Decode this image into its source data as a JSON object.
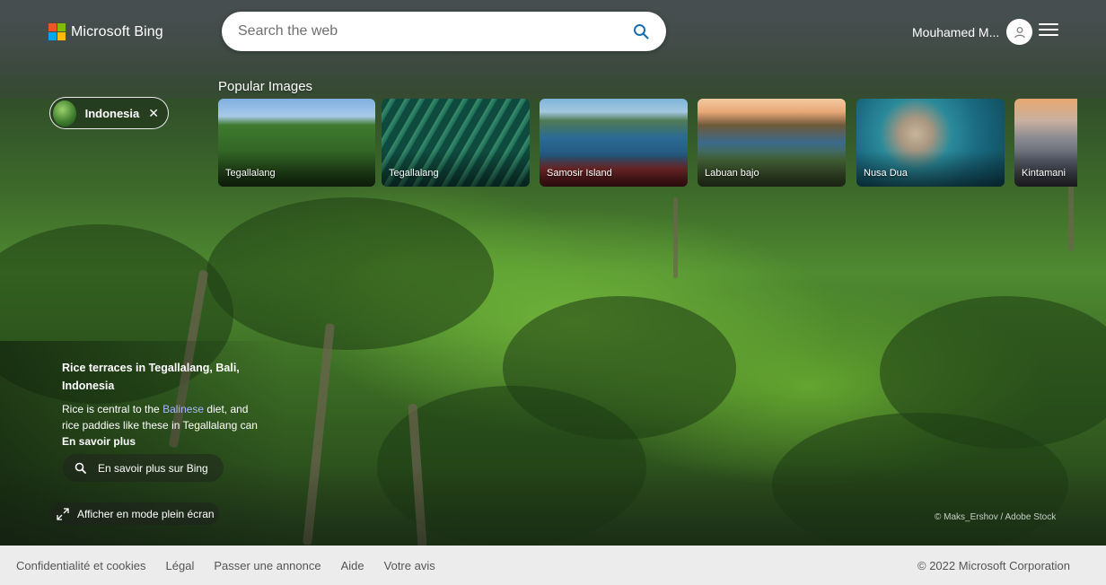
{
  "brand": {
    "name": "Microsoft Bing",
    "logo_colors": [
      "#f35325",
      "#81bc06",
      "#05a6f0",
      "#ffba08"
    ]
  },
  "search": {
    "placeholder": "Search the web",
    "value": ""
  },
  "account": {
    "user_name": "Mouhamed M..."
  },
  "popular": {
    "title": "Popular Images",
    "filter_chip": "Indonesia",
    "cards": [
      {
        "label": "Tegallalang"
      },
      {
        "label": "Tegallalang"
      },
      {
        "label": "Samosir Island"
      },
      {
        "label": "Labuan bajo"
      },
      {
        "label": "Nusa Dua"
      },
      {
        "label": "Kintamani"
      }
    ]
  },
  "info": {
    "title": "Rice terraces in Tegallalang, Bali, Indonesia",
    "desc_before": "Rice is central to the ",
    "desc_link": "Balinese",
    "desc_after": " diet, and rice paddies like these in Tegallalang can",
    "more": "En savoir plus",
    "learn_button": "En savoir plus sur Bing",
    "fullscreen_button": "Afficher en mode plein écran"
  },
  "credit": "© Maks_Ershov / Adobe Stock",
  "footer": {
    "links": [
      "Confidentialité et cookies",
      "Légal",
      "Passer une annonce",
      "Aide",
      "Votre avis"
    ],
    "copyright": "© 2022 Microsoft Corporation"
  }
}
